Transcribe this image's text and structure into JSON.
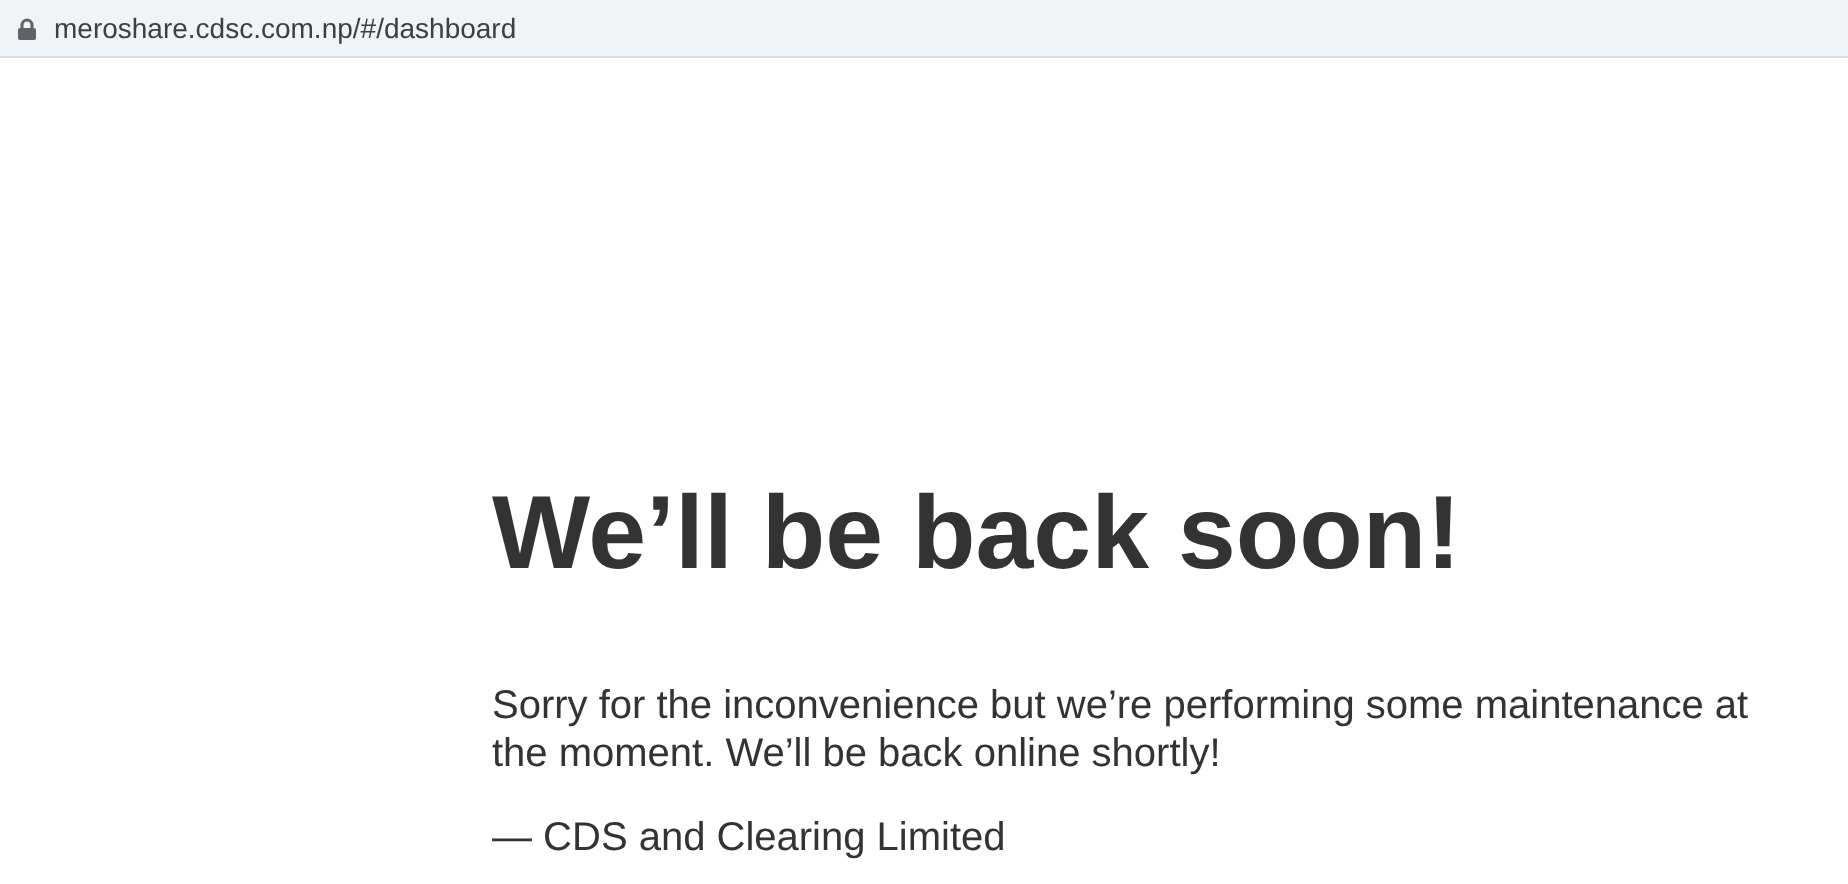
{
  "address_bar": {
    "url": "meroshare.cdsc.com.np/#/dashboard"
  },
  "page": {
    "heading": "We’ll be back soon!",
    "message": "Sorry for the inconvenience but we’re performing some maintenance at the moment. We’ll be back online shortly!",
    "signature": "— CDS and Clearing Limited"
  }
}
